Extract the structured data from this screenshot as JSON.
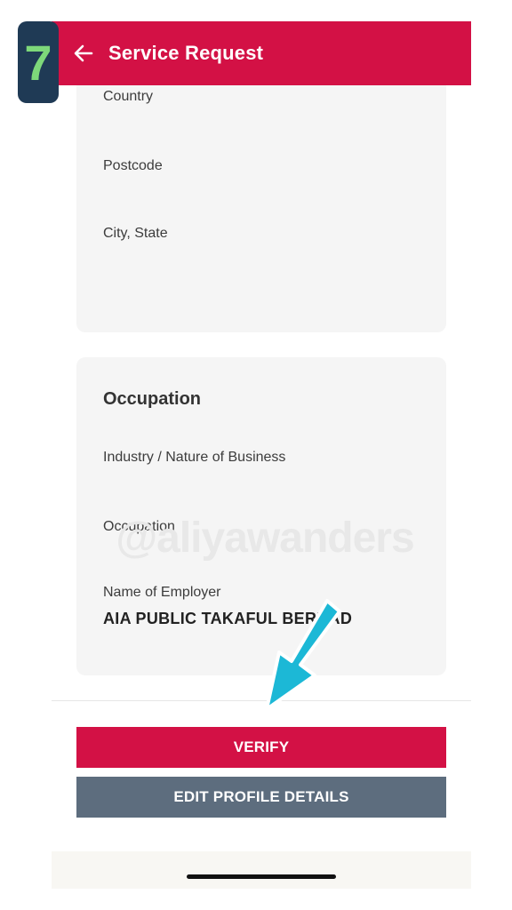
{
  "step_badge": "7",
  "header": {
    "title": "Service Request"
  },
  "address": {
    "fields": [
      {
        "label": "Country"
      },
      {
        "label": "Postcode"
      },
      {
        "label": "City, State"
      }
    ]
  },
  "occupation": {
    "heading": "Occupation",
    "fields": [
      {
        "label": "Industry / Nature of Business"
      },
      {
        "label": "Occupation"
      },
      {
        "label": "Name of Employer",
        "value": "AIA PUBLIC TAKAFUL BERHAD"
      }
    ]
  },
  "watermark": "@aliyawanders",
  "actions": {
    "verify_label": "VERIFY",
    "edit_label": "EDIT PROFILE DETAILS"
  },
  "colors": {
    "brand_red": "#d31145",
    "edit_button": "#5d6d7e",
    "arrow": "#1cb8d6",
    "badge_bg": "#1f3a55",
    "badge_text": "#7dd87a"
  }
}
